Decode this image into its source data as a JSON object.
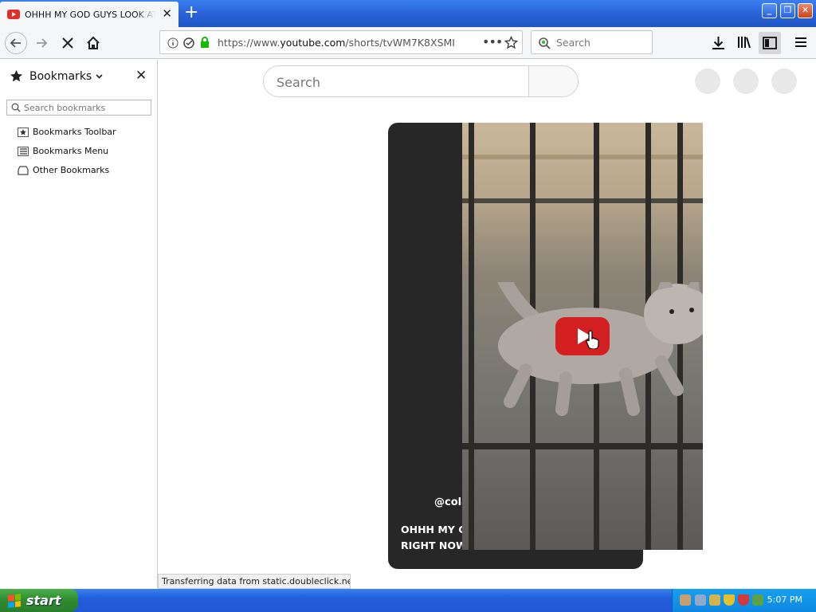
{
  "browser": {
    "tab_title": "OHHH MY GOD GUYS LOOK AT THI",
    "url_prefix": "https://www.",
    "url_domain": "youtube.com",
    "url_path": "/shorts/tvWM7K8XSMI",
    "search_placeholder": "Search",
    "status_text": "Transferring data from static.doubleclick.net..."
  },
  "sidebar": {
    "title": "Bookmarks",
    "search_placeholder": "Search bookmarks",
    "items": [
      {
        "label": "Bookmarks Toolbar",
        "icon": "toolbar-icon"
      },
      {
        "label": "Bookmarks Menu",
        "icon": "menu-icon"
      },
      {
        "label": "Other Bookmarks",
        "icon": "folder-icon"
      }
    ]
  },
  "page": {
    "search_placeholder": "Search",
    "channel": "@cola",
    "video_title_line1": "OHHH MY G",
    "video_title_line2": "RIGHT NOW"
  },
  "taskbar": {
    "start_label": "start",
    "clock": "5:07 PM"
  },
  "colors": {
    "xp_blue": "#2a63d8",
    "yt_red": "#d31f1f",
    "start_green": "#2e8b2e"
  }
}
